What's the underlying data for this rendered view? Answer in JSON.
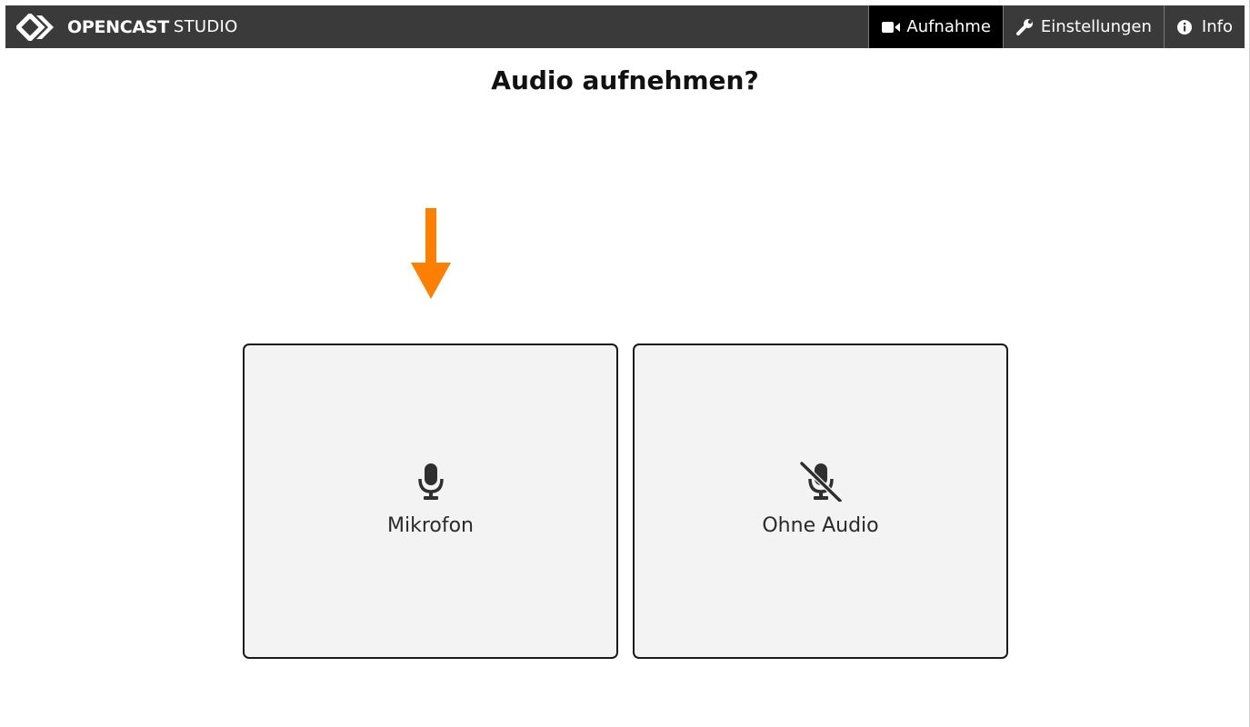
{
  "header": {
    "brand_name": "OPENCAST",
    "brand_suffix": "STUDIO",
    "nav": [
      {
        "label": "Aufnahme",
        "icon": "video-camera-icon",
        "active": true
      },
      {
        "label": "Einstellungen",
        "icon": "wrench-icon",
        "active": false
      },
      {
        "label": "Info",
        "icon": "info-circle-icon",
        "active": false
      }
    ]
  },
  "main": {
    "title": "Audio aufnehmen?",
    "options": [
      {
        "label": "Mikrofon",
        "icon": "microphone-icon"
      },
      {
        "label": "Ohne Audio",
        "icon": "microphone-slash-icon"
      }
    ]
  },
  "colors": {
    "topbar": "#3a3a3a",
    "active_nav": "#000000",
    "arrow": "#ff7f00",
    "card_bg": "#f3f3f3"
  }
}
